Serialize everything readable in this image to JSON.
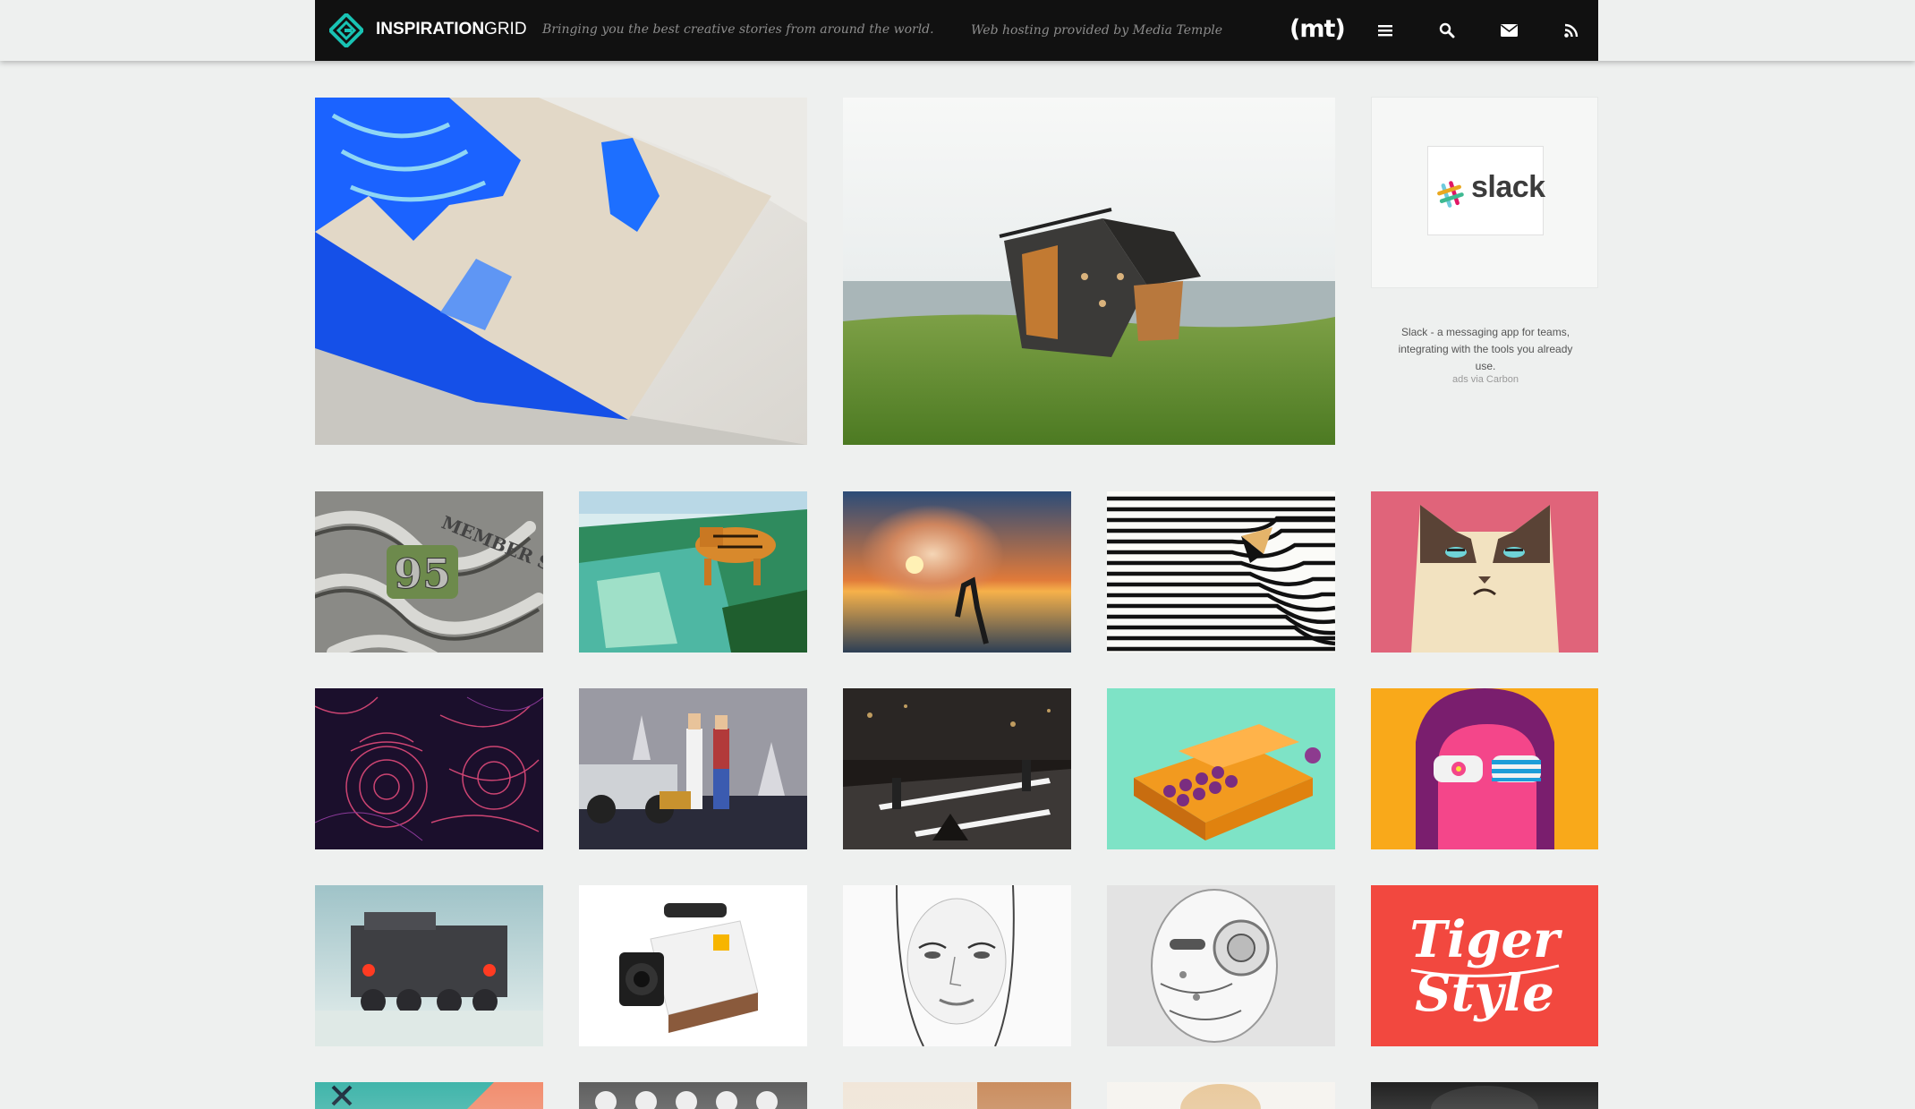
{
  "header": {
    "logo_bold": "INSPIRATION",
    "logo_light": "GRID",
    "tagline": "Bringing you the best creative stories from around the world.",
    "hosting_text": "Web hosting provided by Media Temple",
    "hosting_logo": "(mt)",
    "icons": [
      "menu-icon",
      "search-icon",
      "mail-icon",
      "rss-icon"
    ],
    "accent": "#19c3b4"
  },
  "ad": {
    "brand": "slack",
    "text": "Slack - a messaging app for teams, integrating with the tools you already use.",
    "via": "ads via Carbon"
  },
  "featured": [
    {
      "name": "resin-marble-table"
    },
    {
      "name": "cabin-on-meadow"
    }
  ],
  "grid": [
    {
      "name": "member-since-95-lettering"
    },
    {
      "name": "pixel-tiger-landscape"
    },
    {
      "name": "boiling-water-explosion-sunset"
    },
    {
      "name": "striped-op-art-bird"
    },
    {
      "name": "grumpy-cat-illustration"
    },
    {
      "name": "bb8-line-art"
    },
    {
      "name": "pixel-back-to-the-future"
    },
    {
      "name": "light-seesaws-night"
    },
    {
      "name": "orange-typewriter-illustration"
    },
    {
      "name": "sunglasses-girl-illustration"
    },
    {
      "name": "snow-truck-render"
    },
    {
      "name": "kodak-super8-camera"
    },
    {
      "name": "pencil-portrait"
    },
    {
      "name": "robot-head-render"
    },
    {
      "name": "tiger-style-lettering"
    },
    {
      "name": "partial-tile-1"
    },
    {
      "name": "partial-tile-2"
    },
    {
      "name": "partial-tile-3"
    },
    {
      "name": "partial-tile-4"
    },
    {
      "name": "partial-tile-5"
    }
  ]
}
